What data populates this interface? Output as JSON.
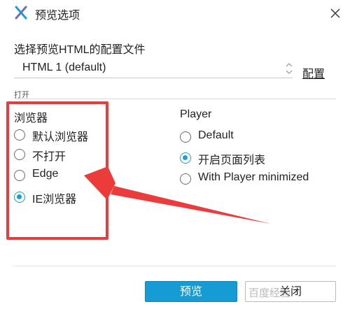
{
  "window": {
    "title": "预览选项",
    "app_icon": "axure-x-icon",
    "close_icon": "close-icon"
  },
  "config": {
    "label": "选择预览HTML的配置文件",
    "selected": "HTML 1 (default)",
    "link": "配置"
  },
  "open_label": "打开",
  "browser_group": {
    "title": "浏览器",
    "options": [
      {
        "label": "默认浏览器",
        "checked": false
      },
      {
        "label": "不打开",
        "checked": false
      },
      {
        "label": "Edge",
        "checked": false
      },
      {
        "label": "IE浏览器",
        "checked": true
      }
    ]
  },
  "player_group": {
    "title": "Player",
    "options": [
      {
        "label": "Default",
        "checked": false
      },
      {
        "label": "开启页面列表",
        "checked": true
      },
      {
        "label": "With Player minimized",
        "checked": false
      }
    ]
  },
  "buttons": {
    "preview": "预览",
    "close": "关闭"
  },
  "annotation": {
    "color": "#ec3b3b"
  },
  "accent_color": "#1e9ecf",
  "watermark": "百度经验"
}
